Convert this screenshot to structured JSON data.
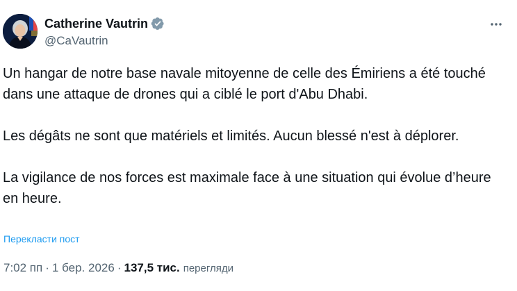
{
  "author": {
    "display_name": "Catherine Vautrin",
    "handle": "@CaVautrin",
    "verified": true,
    "avatar_icon": "profile-photo"
  },
  "post": {
    "paragraphs": [
      "Un hangar de notre base navale mitoyenne de celle des Émiriens a été touché dans une attaque de drones qui a ciblé le port d'Abu Dhabi.",
      "Les dégâts ne sont que matériels et limités. Aucun blessé n'est à déplorer.",
      "La vigilance de nos forces est maximale face à une situation qui évolue d’heure en heure."
    ],
    "translate_label": "Перекласти пост"
  },
  "meta": {
    "time": "7:02 пп",
    "separator": "·",
    "date": "1 бер. 2026",
    "views_count": "137,5 тис.",
    "views_label": "перегляди"
  },
  "icons": {
    "verified": "verified-badge-icon",
    "more": "more-horizontal-icon"
  },
  "colors": {
    "text_primary": "#0f1419",
    "text_secondary": "#536471",
    "link": "#1d9bf0",
    "verified_badge": "#829aab"
  }
}
